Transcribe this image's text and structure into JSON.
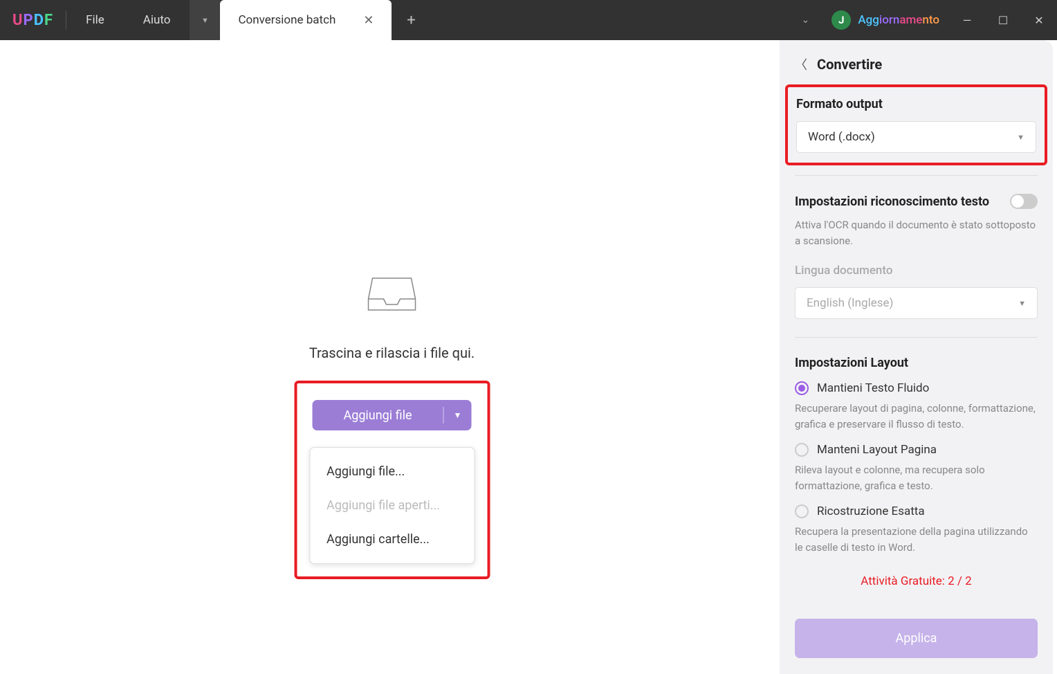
{
  "titlebar": {
    "menu": {
      "file": "File",
      "help": "Aiuto"
    },
    "tab": {
      "label": "Conversione batch"
    },
    "user": {
      "initial": "J",
      "upgrade": "Aggiornamento"
    }
  },
  "main": {
    "drop_text": "Trascina e rilascia i file qui.",
    "add_button": "Aggiungi file",
    "dropdown": {
      "add_files": "Aggiungi file...",
      "add_open_files": "Aggiungi file aperti...",
      "add_folders": "Aggiungi cartelle..."
    }
  },
  "sidebar": {
    "title": "Convertire",
    "output_format": {
      "label": "Formato output",
      "value": "Word (.docx)"
    },
    "ocr": {
      "label": "Impostazioni riconoscimento testo",
      "hint": "Attiva l'OCR quando il documento è stato sottoposto a scansione.",
      "lang_label": "Lingua documento",
      "lang_value": "English (Inglese)"
    },
    "layout": {
      "label": "Impostazioni Layout",
      "opt1": {
        "label": "Mantieni Testo Fluido",
        "desc": "Recuperare layout di pagina, colonne, formattazione, grafica e preservare il flusso di testo."
      },
      "opt2": {
        "label": "Manteni Layout Pagina",
        "desc": "Rileva layout e colonne, ma recupera solo formattazione, grafica e testo."
      },
      "opt3": {
        "label": "Ricostruzione Esatta",
        "desc": "Recupera la presentazione della pagina utilizzando le caselle di testo in Word."
      }
    },
    "free_activity": "Attività Gratuite: 2 / 2",
    "apply": "Applica"
  }
}
